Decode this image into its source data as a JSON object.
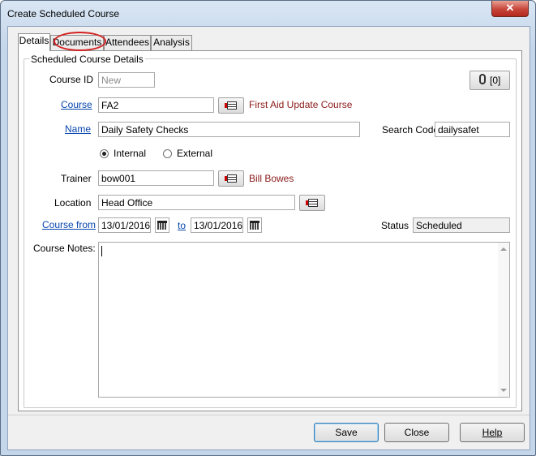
{
  "window": {
    "title": "Create Scheduled Course",
    "close_glyph": "✕"
  },
  "tabs": [
    {
      "label": "Details"
    },
    {
      "label": "Documents"
    },
    {
      "label": "Attendees"
    },
    {
      "label": "Analysis"
    }
  ],
  "group": {
    "title": "Scheduled Course Details"
  },
  "form": {
    "course_id": {
      "label": "Course ID",
      "value": "New"
    },
    "attachments": {
      "label": "[0]",
      "icon": "paperclip-icon"
    },
    "course": {
      "label": "Course",
      "value": "FA2",
      "description": "First Aid Update Course"
    },
    "name": {
      "label": "Name",
      "value": "Daily Safety Checks"
    },
    "search_code": {
      "label": "Search Code",
      "value": "dailysafet"
    },
    "type": {
      "internal_label": "Internal",
      "external_label": "External",
      "selected": "Internal"
    },
    "trainer": {
      "label": "Trainer",
      "value": "bow001",
      "description": "Bill Bowes"
    },
    "location": {
      "label": "Location",
      "value": "Head Office"
    },
    "course_from": {
      "label": "Course from",
      "from_value": "13/01/2016",
      "to_label": "to",
      "to_value": "13/01/2016"
    },
    "status": {
      "label": "Status",
      "value": "Scheduled"
    },
    "notes": {
      "label": "Course Notes:",
      "value": ""
    }
  },
  "buttons": {
    "save": "Save",
    "close": "Close",
    "help": "Help"
  },
  "colors": {
    "link": "#0645ad",
    "description": "#8b1a1a",
    "highlight": "#d42020"
  }
}
